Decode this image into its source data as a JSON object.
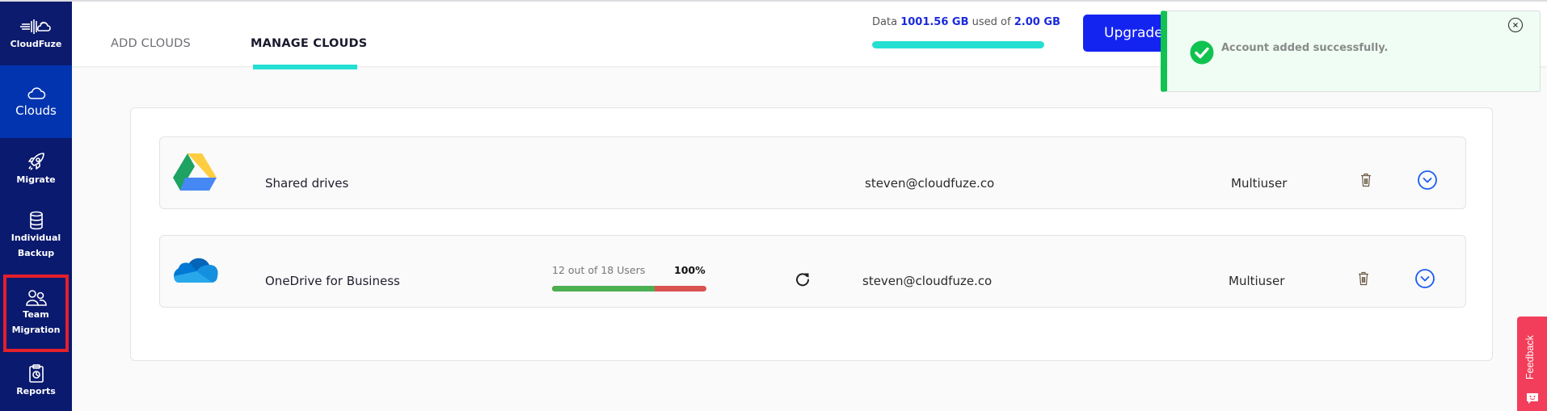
{
  "sidebar": {
    "brand": "CloudFuze",
    "items": [
      {
        "label": "Clouds",
        "icon": "cloud-icon",
        "active": true
      },
      {
        "label": "Migrate",
        "icon": "rocket-icon"
      },
      {
        "label": "Individual Backup",
        "icon": "database-icon"
      },
      {
        "label": "Team Migration",
        "icon": "team-users-icon",
        "highlighted": true
      },
      {
        "label": "Reports",
        "icon": "clipboard-report-icon"
      }
    ]
  },
  "header": {
    "tabs": [
      {
        "label": "ADD CLOUDS",
        "active": false
      },
      {
        "label": "MANAGE CLOUDS",
        "active": true
      }
    ],
    "usage": {
      "prefix": "Data",
      "used": "1001.56 GB",
      "middle": "used of",
      "total": "2.00 GB",
      "fill_percent": 100
    },
    "upgrade_label": "Upgrade"
  },
  "clouds": [
    {
      "name": "Shared drives",
      "provider_icon": "google-drive-icon",
      "email": "steven@cloudfuze.co",
      "type": "Multiuser"
    },
    {
      "name": "OneDrive for Business",
      "provider_icon": "onedrive-icon",
      "users_text": "12 out of 18 Users",
      "percent_text": "100%",
      "users_done": 12,
      "users_total": 18,
      "email": "steven@cloudfuze.co",
      "type": "Multiuser"
    }
  ],
  "toast": {
    "message": "Account added successfully.",
    "status": "success"
  },
  "feedback": {
    "label": "Feedback"
  },
  "colors": {
    "sidebar_bg": "#0a1a6e",
    "sidebar_active": "#0234b0",
    "accent_teal": "#25dfd3",
    "upgrade_blue": "#1424f0",
    "success_green": "#10c24f",
    "progress_green": "#4caf50",
    "progress_red": "#d9534f",
    "feedback_red": "#f23e5b",
    "highlight_red": "#e4202a"
  }
}
